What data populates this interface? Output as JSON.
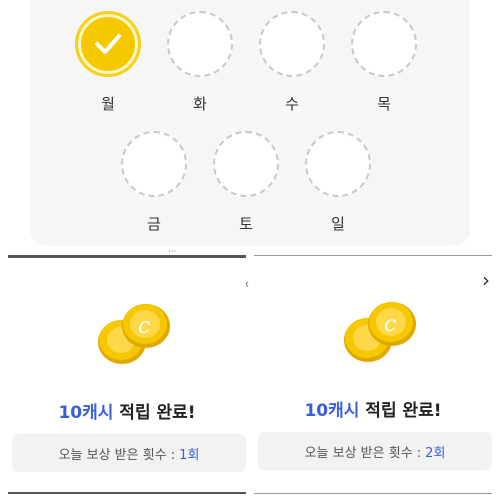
{
  "week": {
    "days": [
      {
        "label": "월",
        "checked": true
      },
      {
        "label": "화",
        "checked": false
      },
      {
        "label": "수",
        "checked": false
      },
      {
        "label": "목",
        "checked": false
      },
      {
        "label": "금",
        "checked": false
      },
      {
        "label": "토",
        "checked": false
      },
      {
        "label": "일",
        "checked": false
      }
    ],
    "check_icon": "check-icon"
  },
  "rewards": [
    {
      "amount": "10캐시",
      "title_suffix": " 적립 완료!",
      "count_label": "오늘 보상 받은 횟수 :",
      "count_value": "1회"
    },
    {
      "amount": "10캐시",
      "title_suffix": " 적립 완료!",
      "count_label": "오늘 보상 받은 횟수 :",
      "count_value": "2회"
    }
  ],
  "nav": {
    "next_icon": "chevron-right-icon",
    "next_glyph": "›"
  },
  "fragments": {
    "cut_text": "···",
    "close_mark": "×"
  },
  "colors": {
    "accent_blue": "#3a5fd8",
    "coin_gold": "#f5c800",
    "check_yellow": "#f5d221"
  }
}
